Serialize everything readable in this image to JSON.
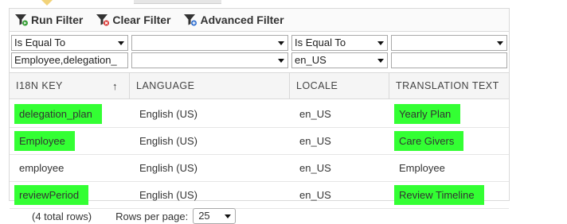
{
  "toolbar": {
    "run_filter": "Run Filter",
    "clear_filter": "Clear Filter",
    "advanced_filter": "Advanced Filter"
  },
  "filters": {
    "row1": {
      "key_operator": "Is Equal To",
      "language_operator": "",
      "locale_operator": "Is Equal To",
      "translation_operator": ""
    },
    "row2": {
      "key_value": "Employee,delegation_",
      "language_value": "",
      "locale_value": "en_US",
      "translation_value": ""
    }
  },
  "columns": [
    "I18N KEY",
    "LANGUAGE",
    "LOCALE",
    "TRANSLATION TEXT"
  ],
  "sort_icon": "up-arrow",
  "rows": [
    {
      "key": "delegation_plan",
      "language": "English (US)",
      "locale": "en_US",
      "translation": "Yearly Plan",
      "highlight_key": true,
      "highlight_translation": true
    },
    {
      "key": "Employee",
      "language": "English (US)",
      "locale": "en_US",
      "translation": "Care Givers",
      "highlight_key": true,
      "highlight_translation": true
    },
    {
      "key": "employee",
      "language": "English (US)",
      "locale": "en_US",
      "translation": "Employee",
      "highlight_key": false,
      "highlight_translation": false
    },
    {
      "key": "reviewPeriod",
      "language": "English (US)",
      "locale": "en_US",
      "translation": "Review Timeline",
      "highlight_key": true,
      "highlight_translation": true
    }
  ],
  "footer": {
    "total_rows": "(4 total rows)",
    "rows_per_page_label": "Rows per page:",
    "rows_per_page_value": "25"
  },
  "colors": {
    "highlight": "#33ff33",
    "border": "#d9d9d9"
  }
}
